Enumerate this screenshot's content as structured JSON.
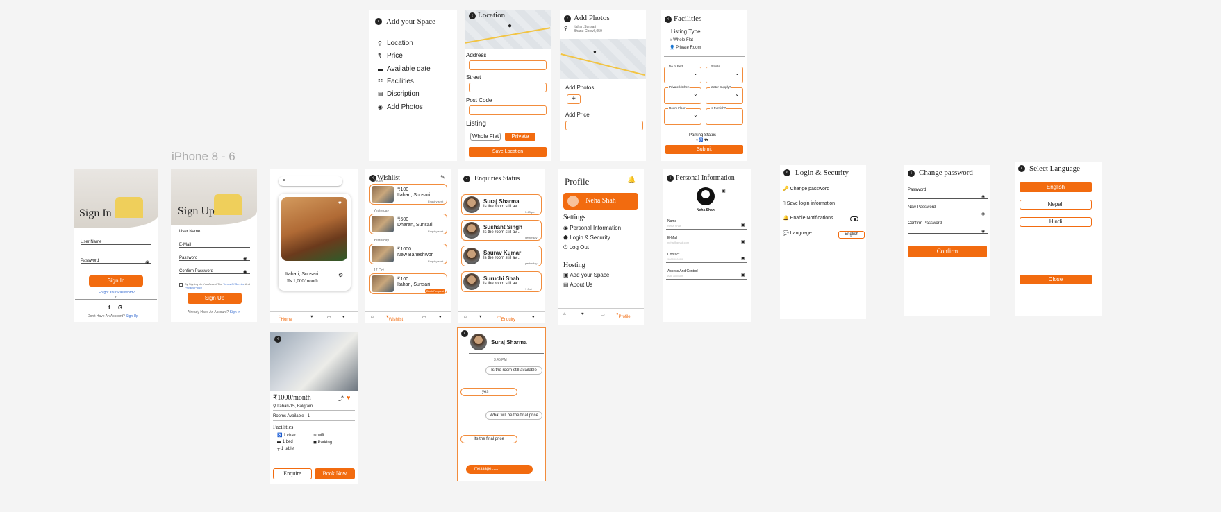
{
  "frame_label": "iPhone 8 - 6",
  "signin": {
    "title": "Sign In",
    "username": "User Name",
    "password": "Password",
    "button": "Sign In",
    "forgot": "Forgot Your Password?",
    "or": "Or",
    "no_account": "Don't Have An Account?",
    "signup_link": "Sign Up"
  },
  "signup": {
    "title": "Sign Up",
    "username": "User Name",
    "email": "E-Mail",
    "password": "Password",
    "confirm": "Confirm Password",
    "terms": "By Signing Up You Accept The",
    "terms_link": "Terms Of Service",
    "and": "And",
    "privacy": "Privacy Policy",
    "button": "Sign Up",
    "have_account": "Already Have An Account?",
    "signin_link": "Sign In"
  },
  "home": {
    "location": "Itahari, Sunsari",
    "price": "Rs.1,000/month",
    "nav": [
      "Home",
      "",
      "",
      ""
    ]
  },
  "detail": {
    "price": "₹1000/month",
    "location": "Itahari-15, Balgram",
    "rooms_label": "Rooms Available",
    "rooms_value": "1",
    "facilities_title": "Facilities",
    "facilities": [
      "1 chair",
      "wifi",
      "1 bed",
      "Parking",
      "1 table"
    ],
    "enquire": "Enquire",
    "book": "Book Now"
  },
  "wishlist": {
    "title": "Wishlist",
    "groups": [
      "Today",
      "Yesterday",
      "Yesterday",
      "17 Oct"
    ],
    "items": [
      {
        "price": "₹100",
        "place": "Itahari, Sunsari",
        "status": "Enquiry sent"
      },
      {
        "price": "₹500",
        "place": "Dharan, Sunsari",
        "status": "Enquiry sent"
      },
      {
        "price": "₹1000",
        "place": "New Baneshwor",
        "status": "Enquiry sent"
      },
      {
        "price": "₹100",
        "place": "Itahari, Sunsari",
        "status": "Book Request"
      }
    ],
    "nav": "Wishlist"
  },
  "enquiries": {
    "title": "Enquiries Status",
    "items": [
      {
        "name": "Suraj Sharma",
        "msg": "Is the room still av...",
        "time": "3:43 pm"
      },
      {
        "name": "Sushant Singh",
        "msg": "Is the room still av...",
        "time": "yesterday"
      },
      {
        "name": "Saurav Kumar",
        "msg": "Is the room still av...",
        "time": "yesterday"
      },
      {
        "name": "Suruchi Shah",
        "msg": "Is the room still av...",
        "time": "1 Oct"
      }
    ],
    "nav": "Enquiry"
  },
  "chat": {
    "name": "Suraj Sharma",
    "time": "3:45 PM",
    "messages": [
      "Is the room still available",
      "yes",
      "What will be the final price",
      "Its the final price"
    ],
    "placeholder": "message......"
  },
  "add_space": {
    "title": "Add your Space",
    "items": [
      "Location",
      "Price",
      "Available date",
      "Facilities",
      "Discription",
      "Add Photos"
    ]
  },
  "location": {
    "title": "Location",
    "address": "Address",
    "street": "Street",
    "postcode": "Post Code",
    "listing": "Listing",
    "whole_flat": "Whole Flat",
    "private": "Private",
    "save": "Save Location"
  },
  "photos": {
    "title": "Add Photos",
    "addr1": "Itahari,Sunsari",
    "addr2": "Bhanu Chowk,059",
    "add_photos": "Add Photos",
    "add_price": "Add Price"
  },
  "facilities": {
    "title": "Facilities",
    "listing_type": "Listing Type",
    "whole_flat": "Whole Flat",
    "private_room": "Private Room",
    "fields": [
      "No of Bed",
      "Private",
      "Private kitchen",
      "Water Supply?",
      "Room Floor",
      "Is Furnish?"
    ],
    "parking": "Parking Status",
    "submit": "Submit"
  },
  "profile": {
    "title": "Profile",
    "name": "Neha Shah",
    "settings": "Settings",
    "settings_items": [
      "Personal Information",
      "Login & Security",
      "Log Out"
    ],
    "hosting": "Hosting",
    "hosting_items": [
      "Add your Space",
      "About Us"
    ],
    "nav": "Profile"
  },
  "personal": {
    "title": "Personal Information",
    "name": "Neha Shah",
    "fields": [
      {
        "label": "Name",
        "value": "Neha Shah"
      },
      {
        "label": "E-Mail",
        "value": "neha@gmail.com"
      },
      {
        "label": "Contact",
        "value": "9800000000"
      },
      {
        "label": "Access And Control",
        "value": "Add account"
      }
    ]
  },
  "security": {
    "title": "Login & Security",
    "items": [
      "Change password",
      "Save login information",
      "Enable Notifications",
      "Language"
    ],
    "language_value": "English"
  },
  "change_pw": {
    "title": "Change password",
    "fields": [
      "Password",
      "New Password",
      "Confirm Password"
    ],
    "button": "Confirm"
  },
  "language": {
    "title": "Select Language",
    "options": [
      "English",
      "Nepali",
      "Hindi"
    ],
    "close": "Close"
  }
}
